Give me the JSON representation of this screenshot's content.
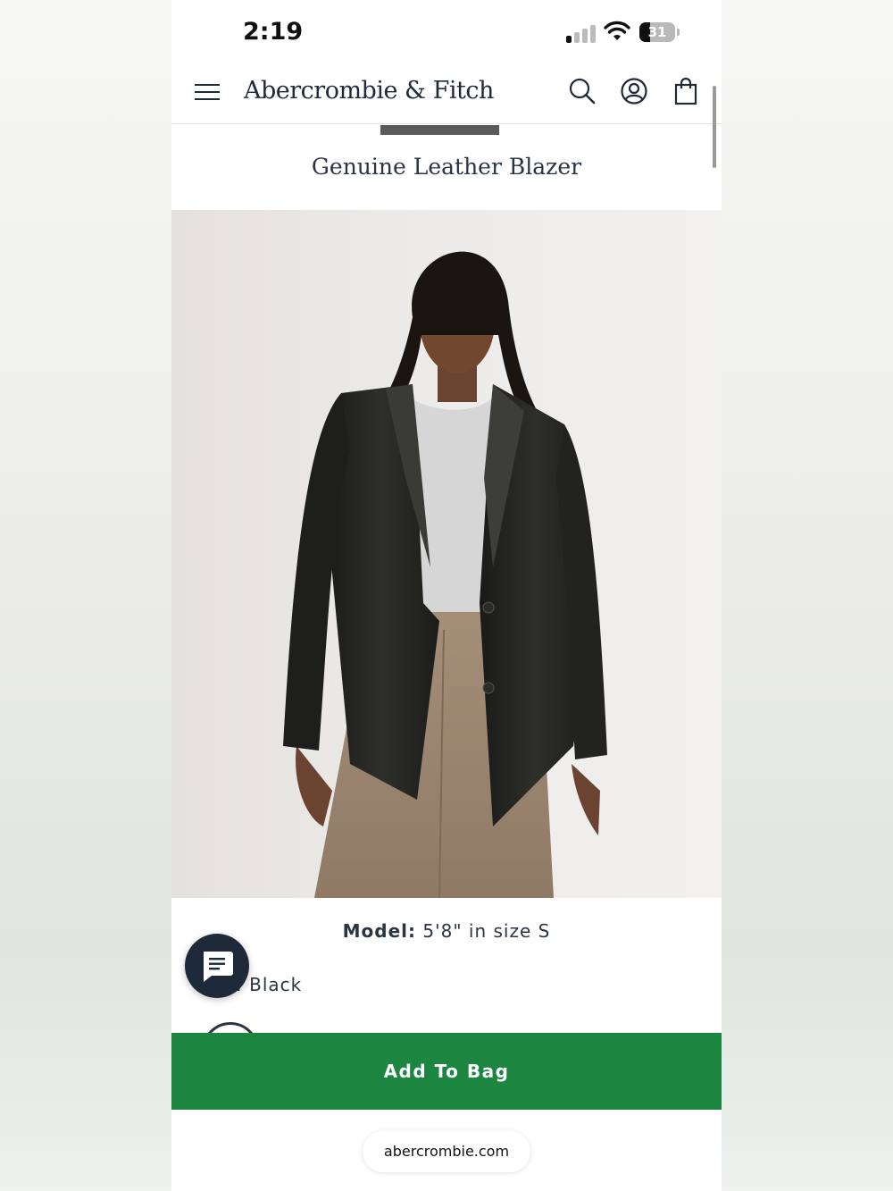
{
  "status_bar": {
    "time": "2:19",
    "battery_level": "31",
    "battery_fraction": 0.31,
    "signal_bars_active": 1,
    "signal_bars_total": 4
  },
  "nav": {
    "brand": "Abercrombie & Fitch",
    "icons": [
      "menu-icon",
      "search-icon",
      "account-icon",
      "shopping-bag-icon"
    ]
  },
  "product": {
    "title": "Genuine Leather Blazer",
    "model_label": "Model:",
    "model_value": "5'8\" in size S",
    "color_label_partial": ":",
    "color_value": "Black"
  },
  "actions": {
    "add_to_bag": "Add To Bag",
    "chat_icon": "chat-icon"
  },
  "browser": {
    "url": "abercrombie.com"
  },
  "colors": {
    "navy": "#1e2a3a",
    "add_to_bag_green": "#1c8540",
    "text": "#2a3544"
  }
}
